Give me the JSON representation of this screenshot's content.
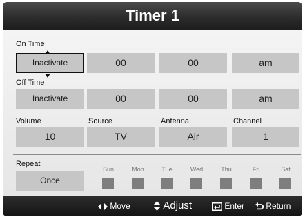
{
  "window": {
    "title": "Timer 1"
  },
  "on_time": {
    "label": "On Time",
    "mode": "Inactivate",
    "hour": "00",
    "minute": "00",
    "ampm": "am"
  },
  "off_time": {
    "label": "Off Time",
    "mode": "Inactivate",
    "hour": "00",
    "minute": "00",
    "ampm": "am"
  },
  "settings": {
    "volume_label": "Volume",
    "volume": "10",
    "source_label": "Source",
    "source": "TV",
    "antenna_label": "Antenna",
    "antenna": "Air",
    "channel_label": "Channel",
    "channel": "1"
  },
  "repeat": {
    "label": "Repeat",
    "value": "Once",
    "days": [
      "Sun",
      "Mon",
      "Tue",
      "Wed",
      "Thu",
      "Fri",
      "Sat"
    ]
  },
  "footer": {
    "move": "Move",
    "adjust": "Adjust",
    "enter": "Enter",
    "return": "Return"
  },
  "colors": {
    "title_bar": "#2a2a2a",
    "field": "#c6c6c6",
    "checkbox": "#7e7e7e",
    "footer": "#141414"
  }
}
